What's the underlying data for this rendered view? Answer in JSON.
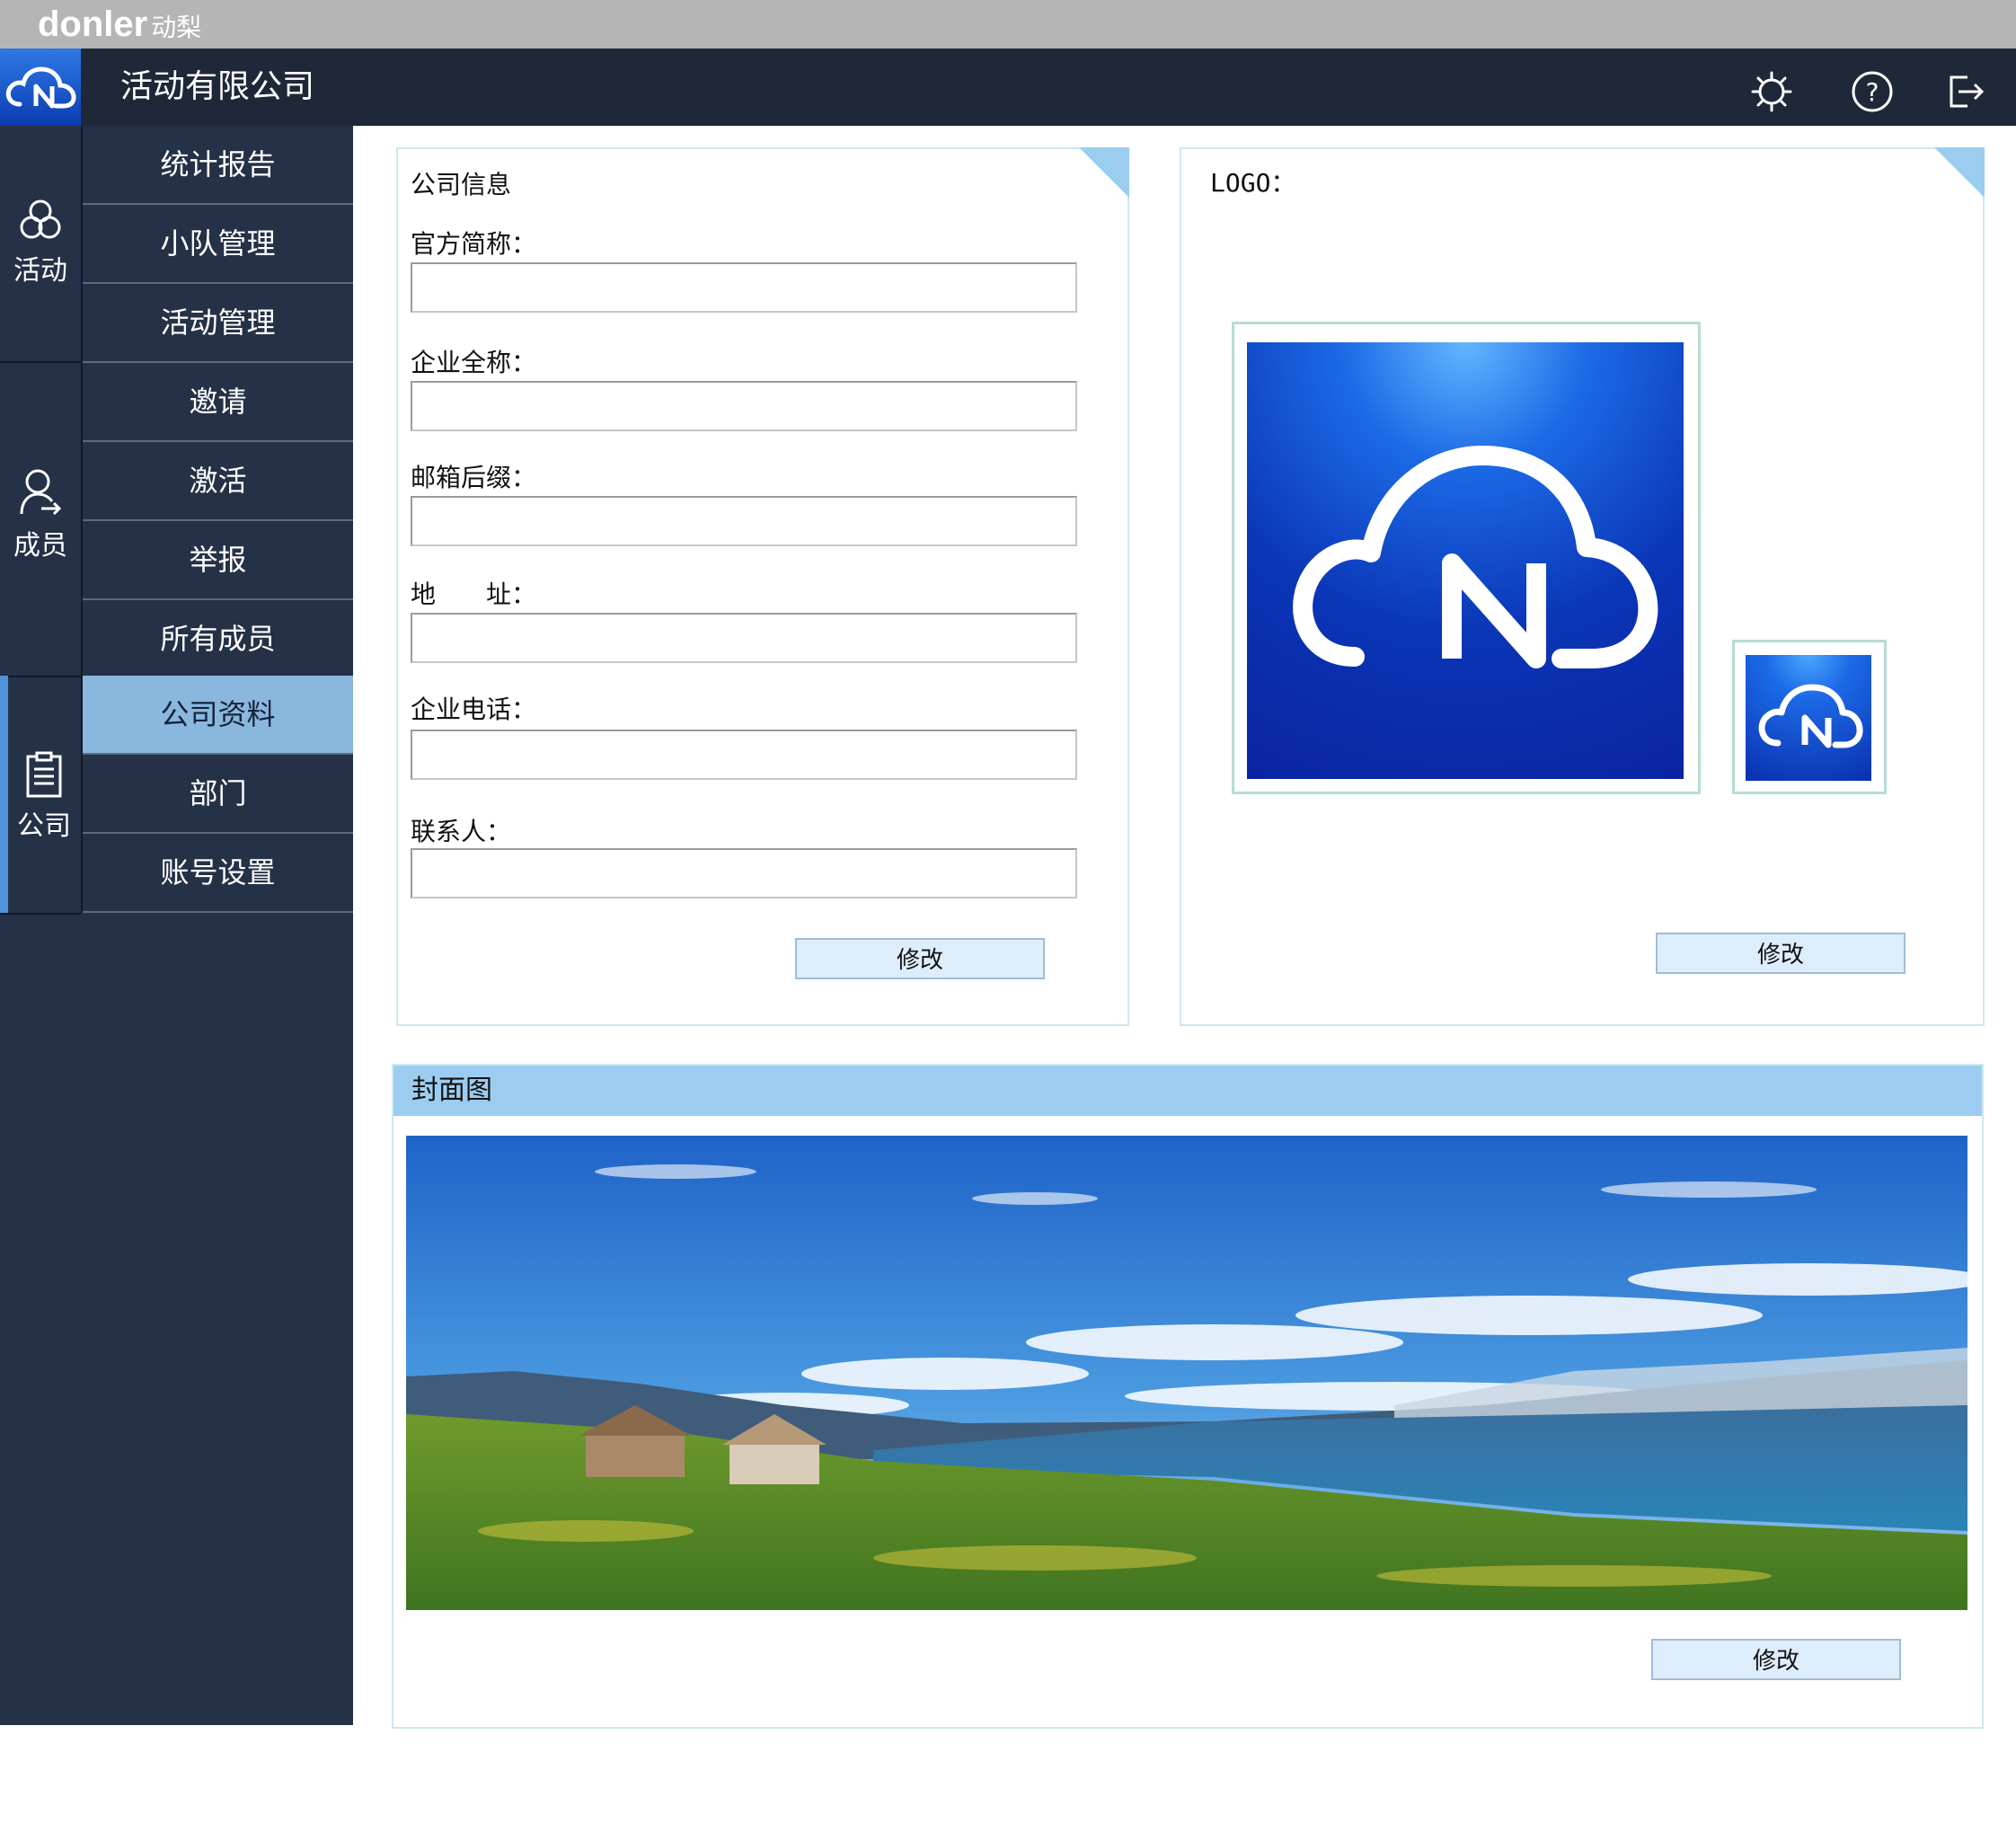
{
  "brand": {
    "name": "donler",
    "name_cn": "动梨"
  },
  "header": {
    "company_name": "活动有限公司",
    "icons": [
      "settings-icon",
      "help-icon",
      "logout-icon"
    ]
  },
  "sidebar": {
    "categories": [
      {
        "label": "活动",
        "icon": "activity-icon"
      },
      {
        "label": "成员",
        "icon": "member-icon"
      },
      {
        "label": "公司",
        "icon": "clipboard-icon"
      }
    ],
    "items": [
      {
        "label": "统计报告"
      },
      {
        "label": "小队管理"
      },
      {
        "label": "活动管理"
      },
      {
        "label": "邀请"
      },
      {
        "label": "激活"
      },
      {
        "label": "举报"
      },
      {
        "label": "所有成员"
      },
      {
        "label": "公司资料",
        "active": true
      },
      {
        "label": "部门"
      },
      {
        "label": "账号设置"
      }
    ]
  },
  "company_info": {
    "title": "公司信息",
    "fields": [
      {
        "label": "官方简称：",
        "value": ""
      },
      {
        "label": "企业全称：",
        "value": ""
      },
      {
        "label": "邮箱后缀：",
        "value": ""
      },
      {
        "label": "地　　址：",
        "value": ""
      },
      {
        "label": "企业电话：",
        "value": ""
      },
      {
        "label": "联系人：",
        "value": ""
      }
    ],
    "edit_button": "修改"
  },
  "logo_panel": {
    "title": "LOGO：",
    "edit_button": "修改"
  },
  "cover_panel": {
    "title": "封面图",
    "edit_button": "修改"
  },
  "colors": {
    "sidebar_bg": "#253146",
    "header_bg": "#1f2838",
    "active_item": "#8ab7de",
    "panel_header": "#9ccdf1",
    "button_bg": "#deedfb"
  }
}
